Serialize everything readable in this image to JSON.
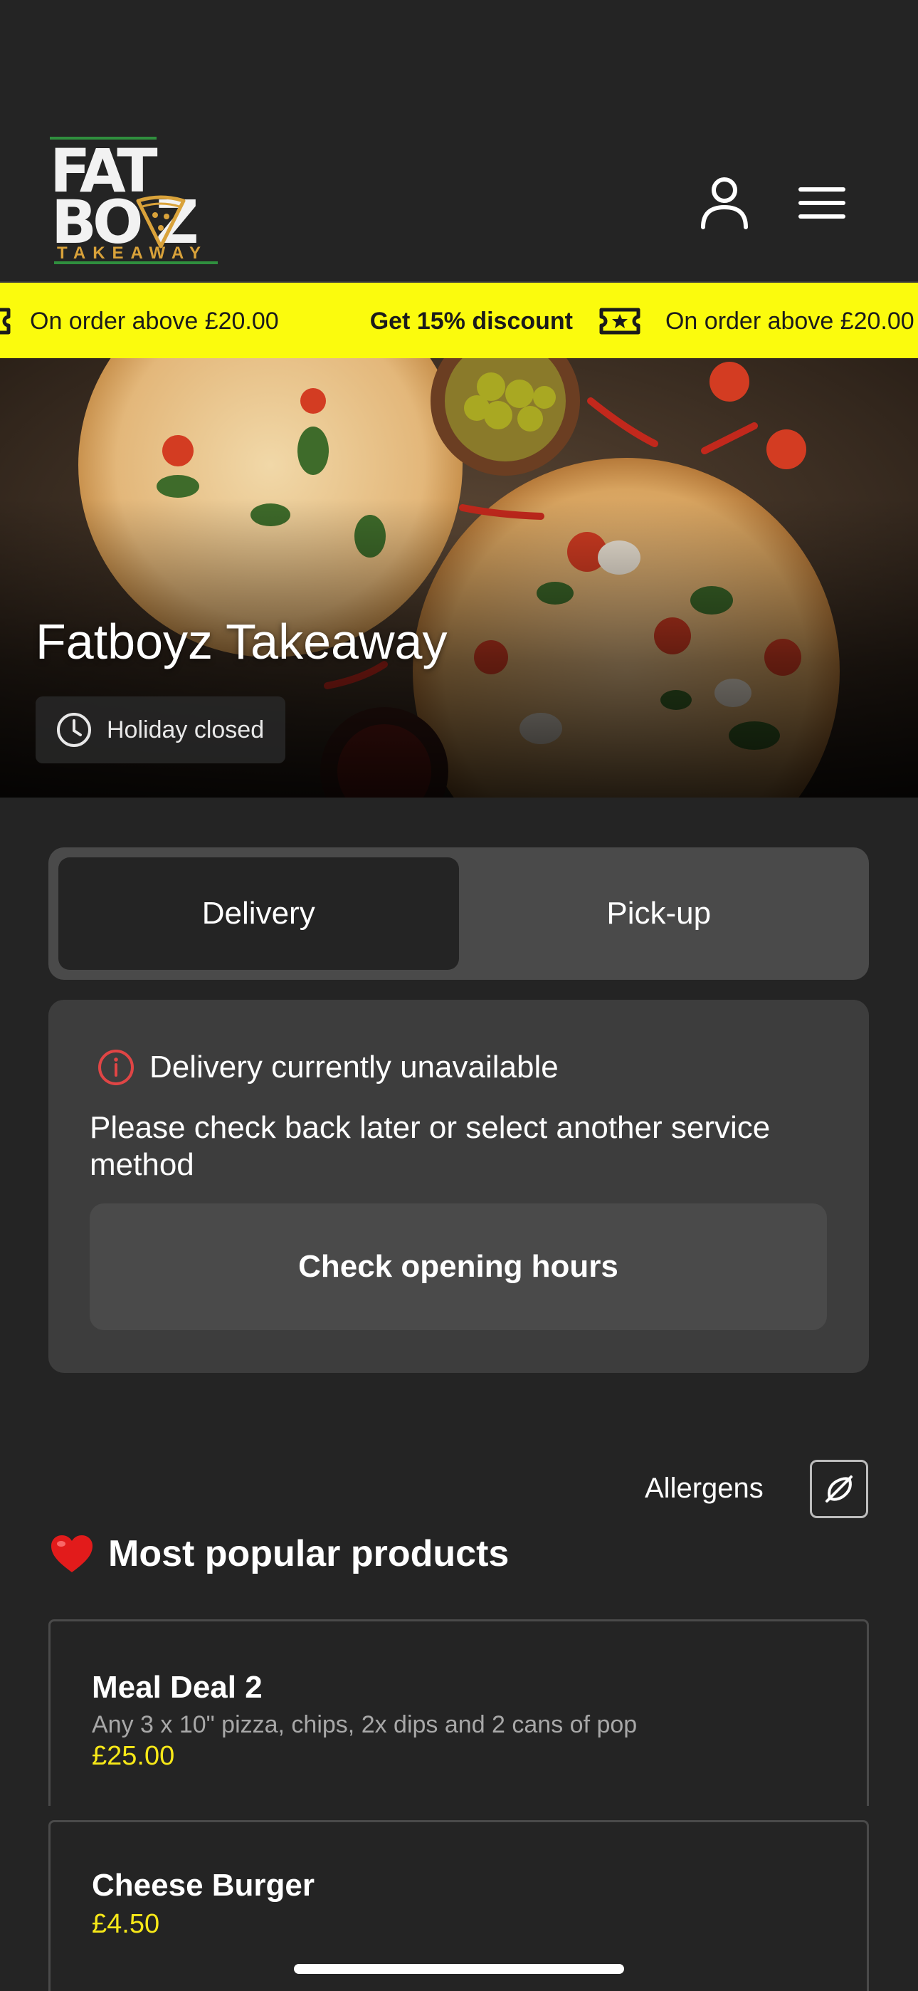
{
  "header": {
    "logo": {
      "line1": "FAT",
      "line2": "BO Z",
      "sub": "TAKEAWAY"
    }
  },
  "promo": {
    "text_left": "On order above £20.00",
    "discount": "Get 15% discount",
    "text_right": "On order above £20.00"
  },
  "hero": {
    "title": "Fatboyz Takeaway",
    "status": "Holiday closed"
  },
  "service": {
    "options": [
      {
        "label": "Delivery",
        "active": true
      },
      {
        "label": "Pick-up",
        "active": false
      }
    ]
  },
  "unavailable": {
    "title": "Delivery currently unavailable",
    "body": "Please check back later or select another service method",
    "button": "Check opening hours"
  },
  "allergens": {
    "label": "Allergens"
  },
  "popular": {
    "title": "Most popular products",
    "products": [
      {
        "name": "Meal Deal 2",
        "description": "Any 3 x 10\" pizza, chips, 2x dips and 2 cans of pop",
        "price": "£25.00"
      },
      {
        "name": "Cheese Burger",
        "price": "£4.50"
      }
    ]
  },
  "colors": {
    "background": "#242424",
    "promo_bar": "#fbfb0d",
    "price": "#f7e818",
    "alert_icon": "#e04545"
  }
}
